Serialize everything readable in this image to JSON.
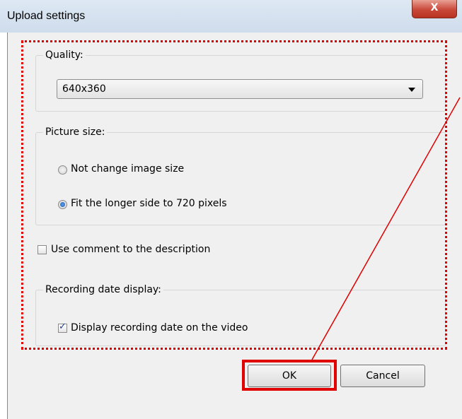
{
  "window": {
    "title": "Upload settings",
    "close_label": "X"
  },
  "quality": {
    "legend": "Quality:",
    "selected": "640x360"
  },
  "picture_size": {
    "legend": "Picture size:",
    "options": [
      {
        "label": "Not change image size",
        "checked": false
      },
      {
        "label": "Fit the longer side to 720 pixels",
        "checked": true
      }
    ]
  },
  "use_comment": {
    "label": "Use comment to the description",
    "checked": false
  },
  "recording_date": {
    "legend": "Recording date display:",
    "checkbox_label": "Display recording date on the video",
    "checked": true
  },
  "buttons": {
    "ok": "OK",
    "cancel": "Cancel"
  },
  "annotation_color": "#e00000"
}
